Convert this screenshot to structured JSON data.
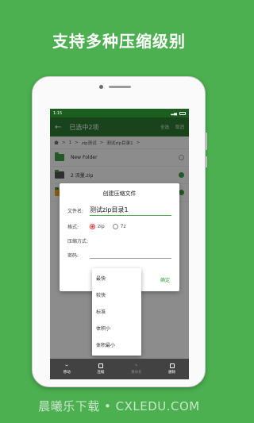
{
  "headline": "支持多种压缩级别",
  "statusbar": {
    "time": "1:15",
    "battery_icon": "battery-icon"
  },
  "toolbar": {
    "title": "已选中2项",
    "select_all": "全选",
    "cancel": "取消"
  },
  "breadcrumb": {
    "segments": [
      ">",
      "1",
      ">",
      "zip测试",
      ">",
      "测试zip目录1",
      ">"
    ]
  },
  "files": [
    {
      "name": "New Folder",
      "checked": false
    },
    {
      "name": "2 流量.zip",
      "checked": true
    },
    {
      "name": "",
      "checked": true
    }
  ],
  "dialog": {
    "title": "创建压缩文件",
    "filename_label": "文件名:",
    "filename_value": "测试zip目录1",
    "format_label": "格式:",
    "formats": [
      "zip",
      "7z"
    ],
    "selected_format": "zip",
    "method_label": "压缩方式:",
    "password_label": "密码:",
    "ok_label": "确定"
  },
  "dropdown": {
    "options": [
      "最快",
      "较快",
      "标准",
      "体积小",
      "体积最小"
    ]
  },
  "bottombar": {
    "items": [
      "移动",
      "压缩",
      "重命名",
      "删除"
    ]
  },
  "watermark": "晨曦乐下载 • CXLEDU.COM",
  "colors": {
    "brand_green": "#4caf50",
    "toolbar_green": "#2e7d32",
    "accent_red": "#e53935"
  }
}
